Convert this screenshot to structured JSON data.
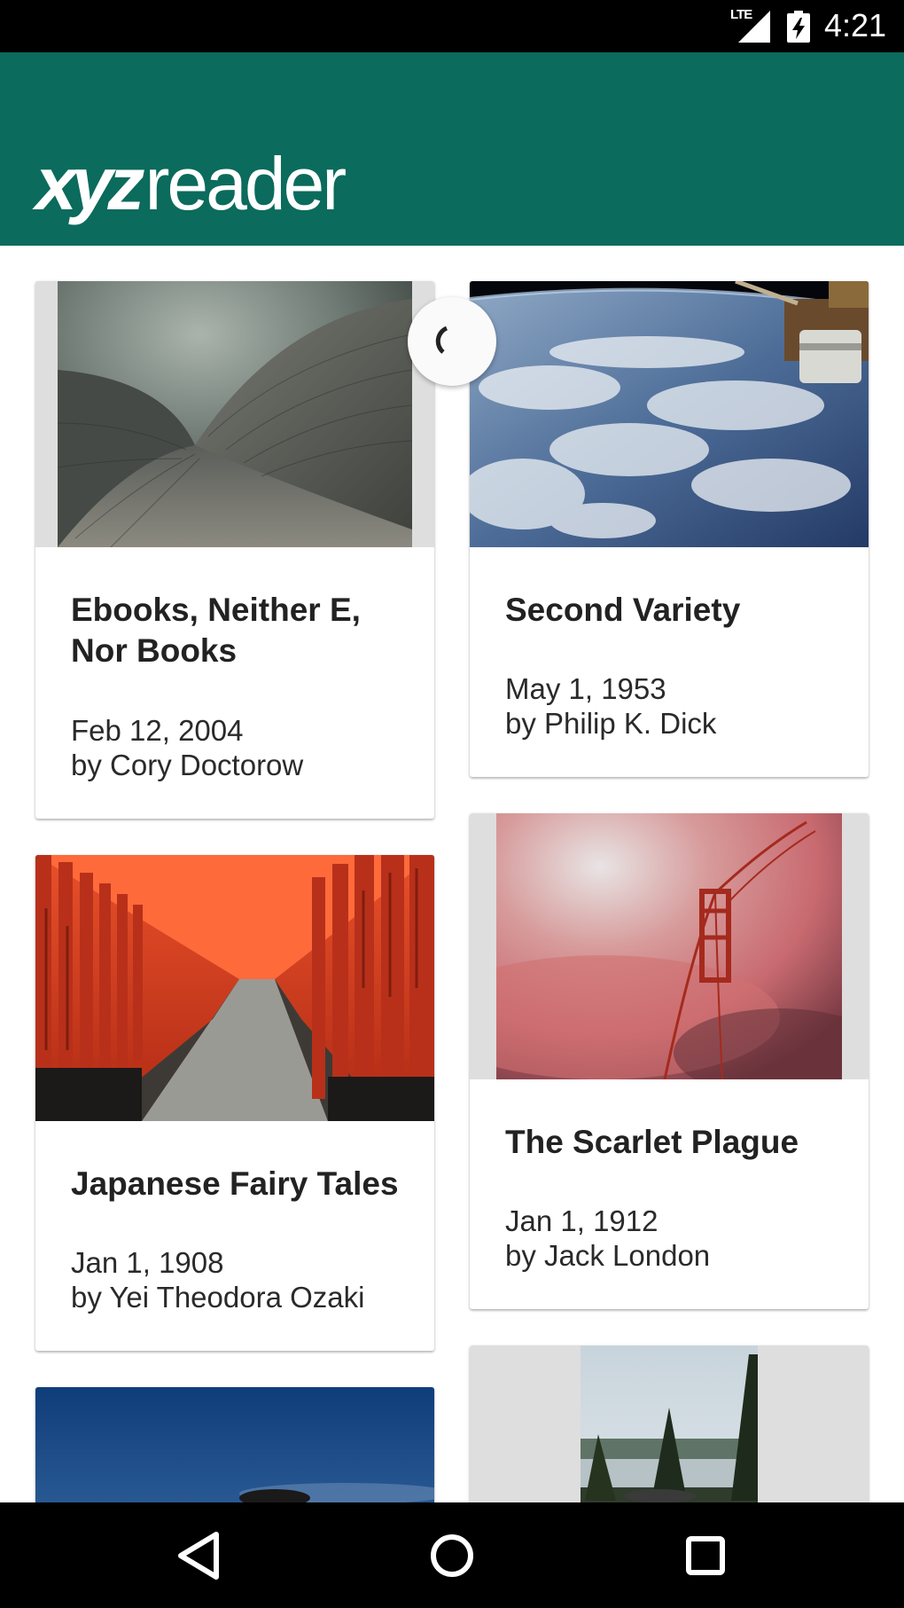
{
  "status_bar": {
    "network_label": "LTE",
    "time": "4:21",
    "icons": [
      "signal-icon",
      "battery-charging-icon"
    ]
  },
  "app_bar": {
    "logo_bold": "xyz",
    "logo_light": "reader",
    "color": "#0b6b5c"
  },
  "articles": [
    {
      "title": "Ebooks, Neither E, Nor Books",
      "date": "Feb 12, 2004",
      "author": "by Cory Doctorow",
      "image": "opera-house-roof-photo"
    },
    {
      "title": "Second Variety",
      "date": "May 1, 1953",
      "author": "by Philip K. Dick",
      "image": "earth-from-space-photo"
    },
    {
      "title": "Japanese Fairy Tales",
      "date": "Jan 1, 1908",
      "author": "by Yei Theodora Ozaki",
      "image": "torii-gates-photo"
    },
    {
      "title": "The Scarlet Plague",
      "date": "Jan 1, 1912",
      "author": "by Jack London",
      "image": "bridge-in-red-fog-photo"
    },
    {
      "image": "night-sky-photo"
    },
    {
      "image": "lake-forest-photo"
    }
  ],
  "loading_spinner": "refresh-spinner-icon",
  "nav_bar": {
    "buttons": [
      "back-icon",
      "home-icon",
      "recents-icon"
    ]
  }
}
